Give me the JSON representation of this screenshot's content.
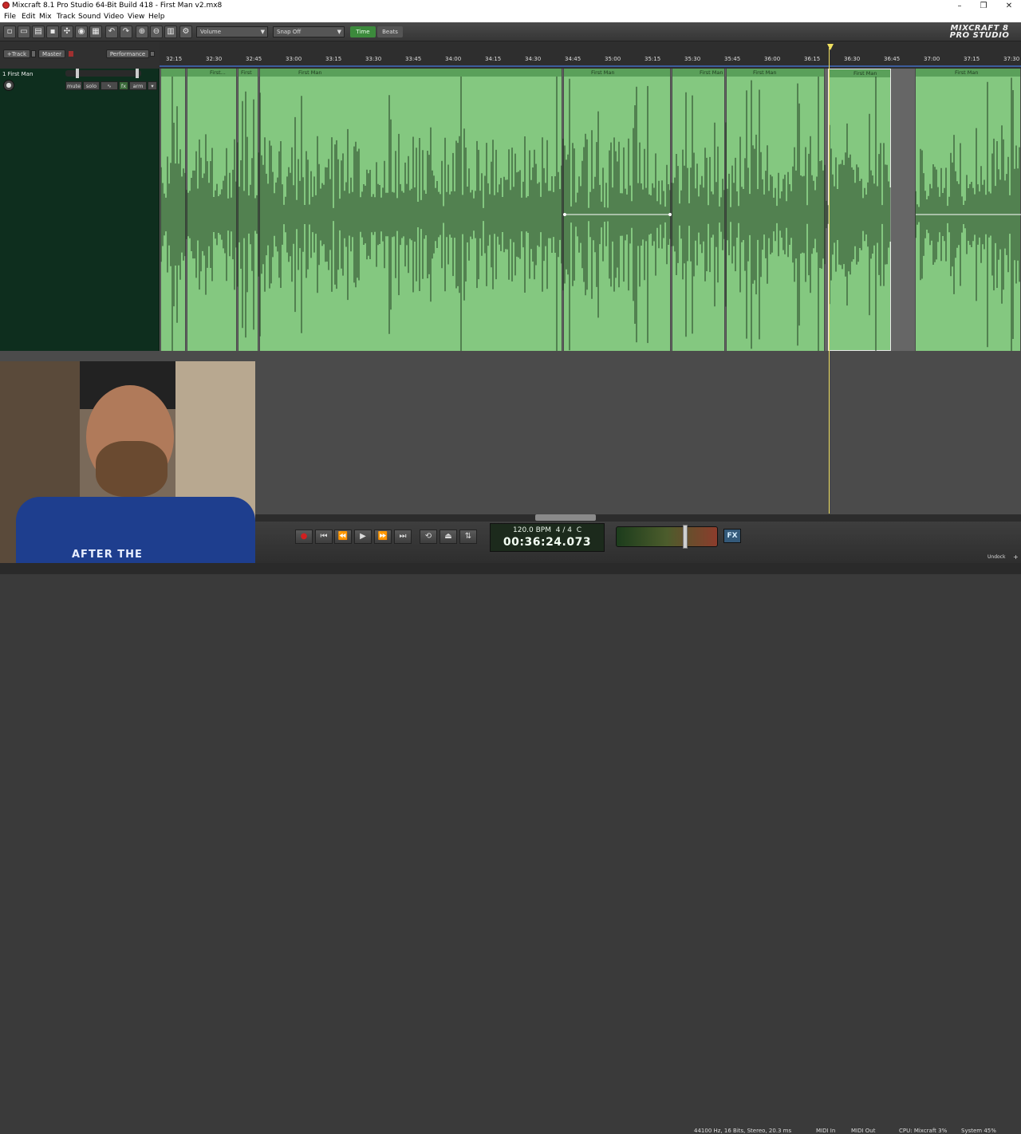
{
  "window": {
    "title": "Mixcraft 8.1 Pro Studio 64-Bit Build 418 - First Man v2.mx8"
  },
  "menu": [
    "File",
    "Edit",
    "Mix",
    "Track",
    "Sound",
    "Video",
    "View",
    "Help"
  ],
  "toolbar": {
    "dropdown_volume": "Volume",
    "dropdown_snap": "Snap Off",
    "time_label": "Time",
    "beats_label": "Beats",
    "logo_line1": "MIXCRAFT 8",
    "logo_line2": "PRO STUDIO"
  },
  "track_header": {
    "add_track": "+Track",
    "master": "Master",
    "performance": "Performance"
  },
  "track": {
    "name": "1 First Man",
    "mute": "mute",
    "solo": "solo",
    "fx": "fx",
    "arm": "arm"
  },
  "ruler_ticks": [
    "32:15",
    "32:30",
    "32:45",
    "33:00",
    "33:15",
    "33:30",
    "33:45",
    "34:00",
    "34:15",
    "34:30",
    "34:45",
    "35:00",
    "35:15",
    "35:30",
    "35:45",
    "36:00",
    "36:15",
    "36:30",
    "36:45",
    "37:00",
    "37:15",
    "37:30"
  ],
  "clips": [
    {
      "label": "First..."
    },
    {
      "label": "First"
    },
    {
      "label": "First Man"
    },
    {
      "label": "First Man"
    },
    {
      "label": "First Man"
    },
    {
      "label": "First Man"
    },
    {
      "label": "First Man"
    },
    {
      "label": "First Man"
    }
  ],
  "transport": {
    "bpm": "120.0 BPM",
    "time_sig": "4 / 4",
    "key": "C",
    "time": "00:36:24.073",
    "fx": "FX"
  },
  "status": {
    "audio_format": "44100 Hz, 16 Bits, Stereo, 20.3 ms",
    "midi_in": "MIDI In",
    "midi_out": "MIDI Out",
    "cpu": "CPU: Mixcraft 3%",
    "system": "System 45%",
    "undock": "Undock"
  },
  "webcam_text": "AFTER THE",
  "colors": {
    "clip_green": "#84c880",
    "clip_header": "#5aa05a",
    "track_panel": "#0e2e1e",
    "playhead": "#f0e060"
  }
}
